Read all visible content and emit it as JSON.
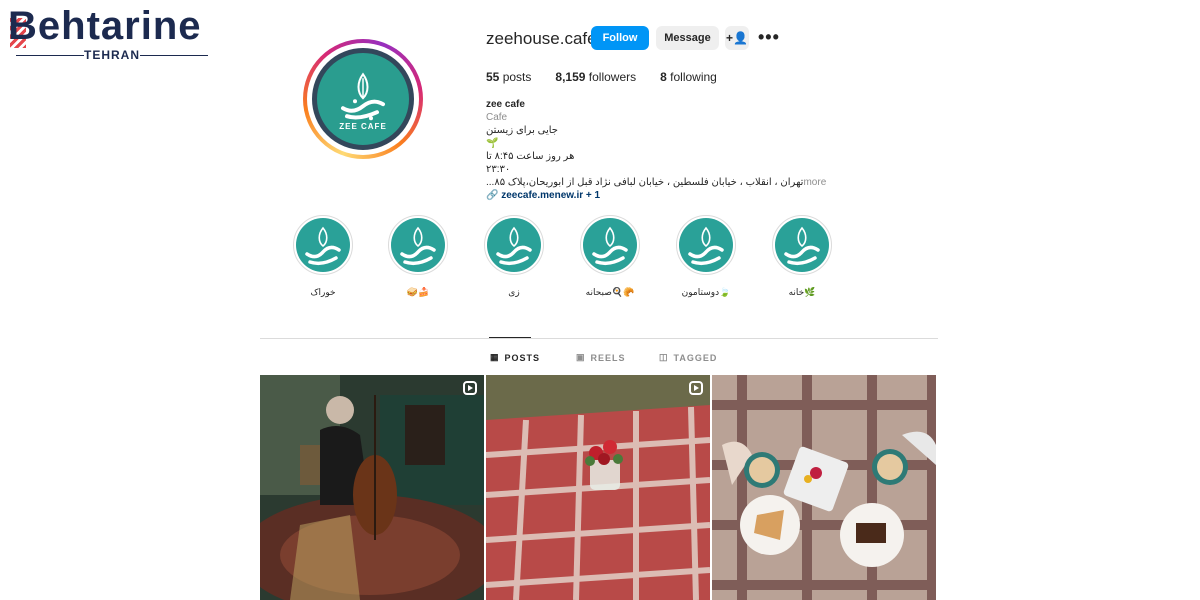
{
  "watermark": {
    "brand": "Behtarine",
    "city": "TEHRAN"
  },
  "profile": {
    "username": "zeehouse.cafe",
    "avatar_brand": "ZEE CAFE",
    "buttons": {
      "follow": "Follow",
      "message": "Message",
      "suggest_icon": "+👤",
      "more": "•••"
    },
    "stats": [
      {
        "value": "55",
        "label": "posts"
      },
      {
        "value": "8,159",
        "label": "followers"
      },
      {
        "value": "8",
        "label": "following"
      }
    ],
    "bio": {
      "name": "zee cafe",
      "category": "Cafe",
      "line1": "جایی برای زیستن🌱",
      "line2": "هر روز ساعت ۸:۴۵ تا ۲۳:۳۰",
      "line3": "تهران ، انقلاب ، خیابان فلسطین ، خیابان لبافی نژاد قبل از ابوریحان،پلاک ۸۵...",
      "more": "more",
      "link": "zeecafe.menew.ir",
      "link_extra": "+ 1"
    }
  },
  "highlights": [
    {
      "label": "خوراک"
    },
    {
      "label": "🥪🍰"
    },
    {
      "label": "زی"
    },
    {
      "label": "صبحانه🍳🥐"
    },
    {
      "label": "دوستامون🍃"
    },
    {
      "label": "خانه🌿"
    }
  ],
  "tabs": [
    {
      "icon": "grid-icon",
      "glyph": "▦",
      "label": "POSTS",
      "active": true
    },
    {
      "icon": "reels-icon",
      "glyph": "▣",
      "label": "REELS",
      "active": false
    },
    {
      "icon": "tagged-icon",
      "glyph": "◫",
      "label": "TAGGED",
      "active": false
    }
  ],
  "colors": {
    "follow": "#0095f6",
    "teal": "#2aa198",
    "ring": "#d62976"
  }
}
